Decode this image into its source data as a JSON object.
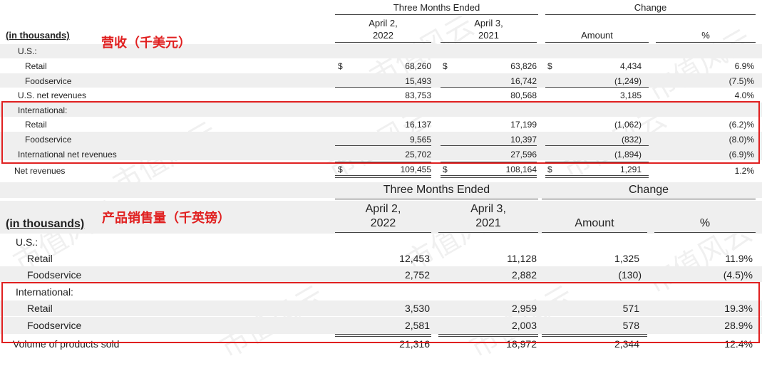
{
  "watermark": "市值风云",
  "table1": {
    "annotation": "营收（千美元）",
    "in_thousands": "(in thousands)",
    "group_header": "Three Months Ended",
    "change_header": "Change",
    "col1": [
      "April 2,",
      "2022"
    ],
    "col2": [
      "April 3,",
      "2021"
    ],
    "amount": "Amount",
    "pct": "%",
    "rows": [
      {
        "label": "U.S.:",
        "v1": "",
        "v2": "",
        "amt": "",
        "pct": ""
      },
      {
        "label": "Retail",
        "s1": "$",
        "v1": "68,260",
        "s2": "$",
        "v2": "63,826",
        "s3": "$",
        "amt": "4,434",
        "pct": "6.9%"
      },
      {
        "label": "Foodservice",
        "v1": "15,493",
        "v2": "16,742",
        "amt": "(1,249)",
        "pct": "(7.5)%"
      },
      {
        "label": "U.S. net revenues",
        "v1": "83,753",
        "v2": "80,568",
        "amt": "3,185",
        "pct": "4.0%"
      },
      {
        "label": "International:",
        "v1": "",
        "v2": "",
        "amt": "",
        "pct": ""
      },
      {
        "label": "Retail",
        "v1": "16,137",
        "v2": "17,199",
        "amt": "(1,062)",
        "pct": "(6.2)%"
      },
      {
        "label": "Foodservice",
        "v1": "9,565",
        "v2": "10,397",
        "amt": "(832)",
        "pct": "(8.0)%"
      },
      {
        "label": "International net revenues",
        "v1": "25,702",
        "v2": "27,596",
        "amt": "(1,894)",
        "pct": "(6.9)%"
      },
      {
        "label": "Net revenues",
        "s1": "$",
        "v1": "109,455",
        "s2": "$",
        "v2": "108,164",
        "s3": "$",
        "amt": "1,291",
        "pct": "1.2%"
      }
    ]
  },
  "table2": {
    "annotation": "产品销售量（千英镑）",
    "in_thousands": "(in thousands)",
    "group_header": "Three Months Ended",
    "change_header": "Change",
    "col1": [
      "April 2,",
      "2022"
    ],
    "col2": [
      "April 3,",
      "2021"
    ],
    "amount": "Amount",
    "pct": "%",
    "rows": [
      {
        "label": "U.S.:",
        "v1": "",
        "v2": "",
        "amt": "",
        "pct": ""
      },
      {
        "label": "Retail",
        "v1": "12,453",
        "v2": "11,128",
        "amt": "1,325",
        "pct": "11.9%"
      },
      {
        "label": "Foodservice",
        "v1": "2,752",
        "v2": "2,882",
        "amt": "(130)",
        "pct": "(4.5)%"
      },
      {
        "label": "International:",
        "v1": "",
        "v2": "",
        "amt": "",
        "pct": ""
      },
      {
        "label": "Retail",
        "v1": "3,530",
        "v2": "2,959",
        "amt": "571",
        "pct": "19.3%"
      },
      {
        "label": "Foodservice",
        "v1": "2,581",
        "v2": "2,003",
        "amt": "578",
        "pct": "28.9%"
      },
      {
        "label": "Volume of products sold",
        "v1": "21,316",
        "v2": "18,972",
        "amt": "2,344",
        "pct": "12.4%"
      }
    ]
  }
}
